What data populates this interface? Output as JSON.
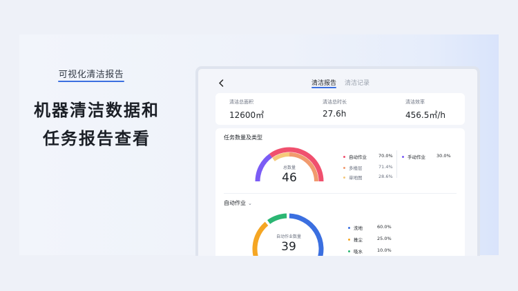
{
  "promo": {
    "tagline": "可视化清洁报告",
    "headline_line1": "机器清洁数据和",
    "headline_line2": "任务报告查看"
  },
  "header": {
    "back_icon": "chevron-left-icon",
    "tabs": [
      {
        "label": "清洁报告",
        "active": true
      },
      {
        "label": "清洁记录",
        "active": false
      }
    ],
    "accent_color": "#3b6fe0"
  },
  "stats": [
    {
      "label": "清洁总面积",
      "value": "12600㎡"
    },
    {
      "label": "清洁总时长",
      "value": "27.6h"
    },
    {
      "label": "清洁效率",
      "value": "456.5㎡/h"
    }
  ],
  "task_section": {
    "title": "任务数量及类型",
    "center_label": "总数量",
    "center_value": "46",
    "legend": [
      {
        "name": "自动作业",
        "value": "70.0%",
        "color": "#f0506e",
        "level": 0
      },
      {
        "name": "多楼层",
        "value": "71.4%",
        "color": "#f19a6e",
        "level": 1
      },
      {
        "name": "单地图",
        "value": "28.6%",
        "color": "#f5c97a",
        "level": 1
      },
      {
        "name": "手动作业",
        "value": "30.0%",
        "color": "#7b5cf5",
        "level": 0
      }
    ]
  },
  "auto_section": {
    "dropdown_label": "自动作业",
    "center_label": "自动作业数量",
    "center_value": "39",
    "legend": [
      {
        "name": "洗地",
        "value": "60.0%",
        "color": "#3b6fe0"
      },
      {
        "name": "推尘",
        "value": "25.0%",
        "color": "#f5a623"
      },
      {
        "name": "吸水",
        "value": "10.0%",
        "color": "#2bb673"
      }
    ]
  },
  "chart_data": [
    {
      "type": "pie",
      "title": "任务数量及类型",
      "total": 46,
      "series": [
        {
          "name": "自动作业",
          "values": [
            70.0
          ],
          "children": [
            {
              "name": "多楼层",
              "value": 71.4
            },
            {
              "name": "单地图",
              "value": 28.6
            }
          ]
        },
        {
          "name": "手动作业",
          "values": [
            30.0
          ]
        }
      ]
    },
    {
      "type": "pie",
      "title": "自动作业",
      "total": 39,
      "categories": [
        "洗地",
        "推尘",
        "吸水"
      ],
      "values": [
        60.0,
        25.0,
        10.0
      ]
    }
  ]
}
